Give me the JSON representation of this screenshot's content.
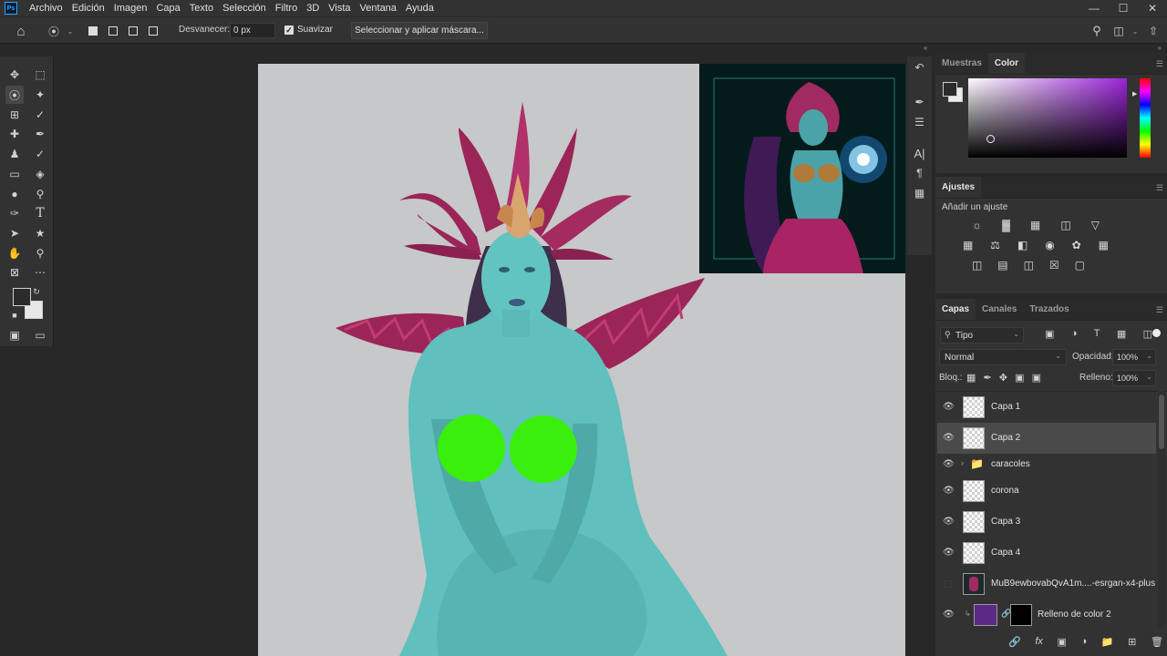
{
  "app": {
    "logo": "Ps"
  },
  "menu": [
    "Archivo",
    "Edición",
    "Imagen",
    "Capa",
    "Texto",
    "Selección",
    "Filtro",
    "3D",
    "Vista",
    "Ventana",
    "Ayuda"
  ],
  "options": {
    "desvanecer_label": "Desvanecer:",
    "desvanecer_value": "0 px",
    "suavizar_label": "Suavizar",
    "suavizar_checked": true,
    "mask_button": "Seleccionar y aplicar máscara..."
  },
  "panels": {
    "color_tabs": [
      "Muestras",
      "Color"
    ],
    "color_active_tab": "Color",
    "picker_hue": "#9b24d8",
    "adjust_title": "Ajustes",
    "adjust_hint": "Añadir un ajuste",
    "layers_tabs": [
      "Capas",
      "Canales",
      "Trazados"
    ],
    "filter_kind": "Tipo",
    "blend_mode": "Normal",
    "opacity_label": "Opacidad:",
    "opacity_value": "100%",
    "lock_label": "Bloq.:",
    "fill_label": "Relleno:",
    "fill_value": "100%"
  },
  "layers": [
    {
      "name": "Capa 1",
      "visible": true,
      "selected": false
    },
    {
      "name": "Capa 2",
      "visible": true,
      "selected": true
    },
    {
      "name": "caracoles",
      "visible": true,
      "selected": false,
      "group": true
    },
    {
      "name": "corona",
      "visible": true,
      "selected": false
    },
    {
      "name": "Capa 3",
      "visible": true,
      "selected": false
    },
    {
      "name": "Capa 4",
      "visible": true,
      "selected": false
    },
    {
      "name": "MuB9ewbovabQvA1m....-esrgan-x4-plus",
      "visible": false,
      "selected": false
    },
    {
      "name": "Relleno de color 2",
      "visible": true,
      "selected": false,
      "fill": "#5a2a86"
    }
  ],
  "colors": {
    "skin": "#5fc0bd",
    "crown": "#9b2558",
    "censor": "#39f00c",
    "canvas_bg": "#c6c8c9"
  }
}
